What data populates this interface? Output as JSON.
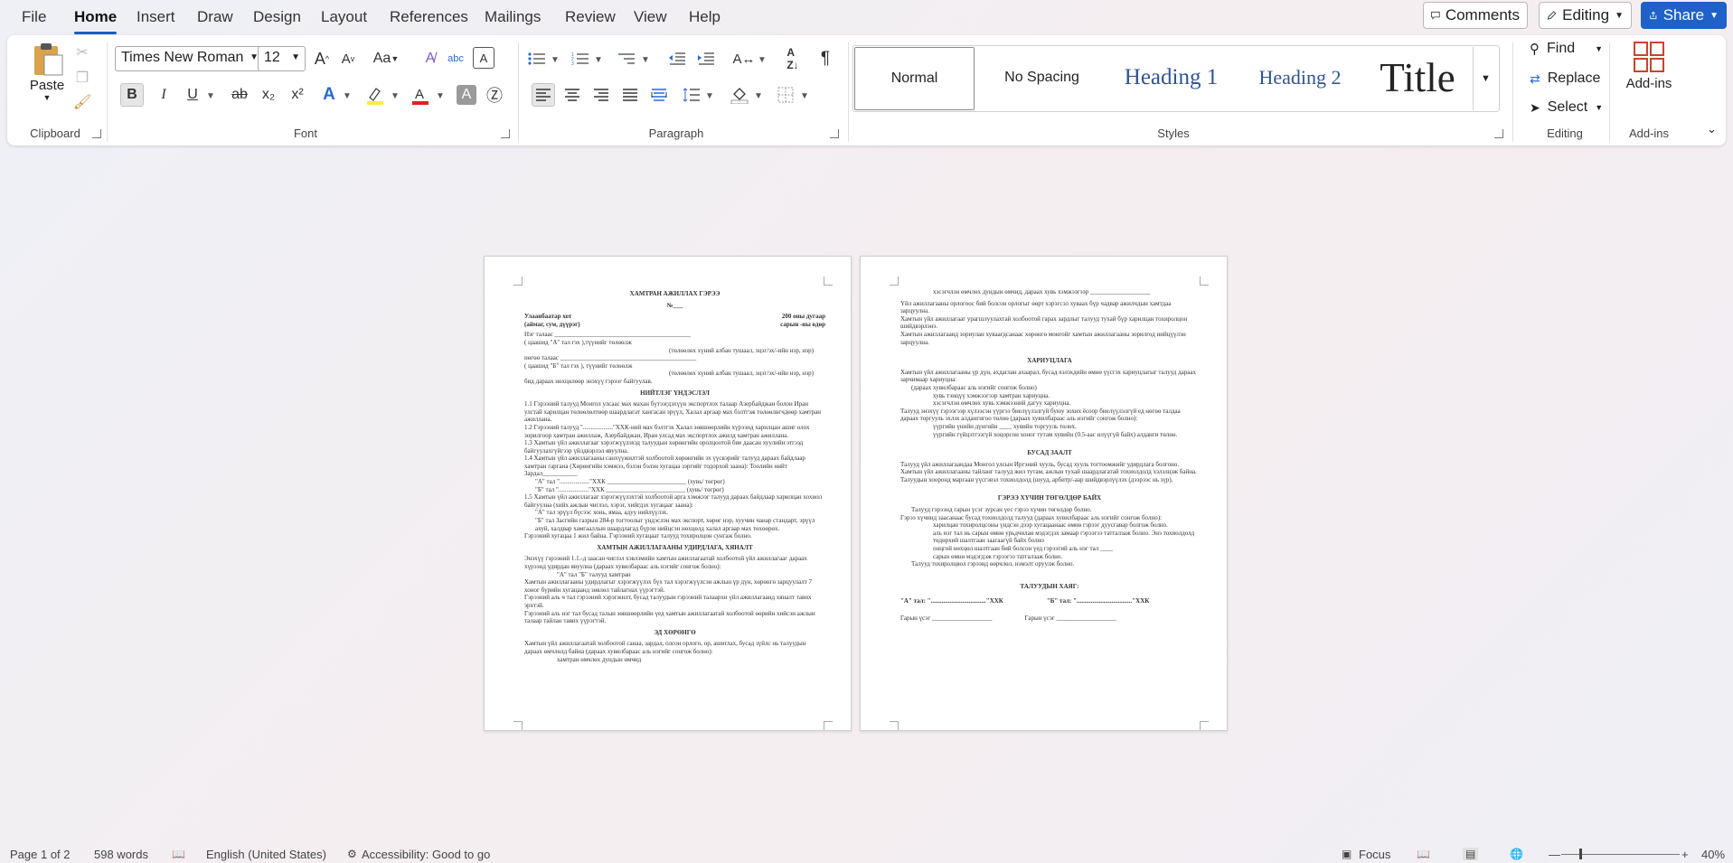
{
  "menu": {
    "items": [
      "File",
      "Home",
      "Insert",
      "Draw",
      "Design",
      "Layout",
      "References",
      "Mailings",
      "Review",
      "View",
      "Help"
    ],
    "active": "Home"
  },
  "topbar": {
    "comments": "Comments",
    "editing": "Editing",
    "share": "Share"
  },
  "ribbon": {
    "clipboard": {
      "paste": "Paste",
      "label": "Clipboard"
    },
    "font": {
      "name": "Times New Roman",
      "size": "12",
      "label": "Font",
      "bold": "B",
      "italic": "I",
      "underline": "U",
      "strike": "ab",
      "sub": "x₂",
      "sup": "x²",
      "case": "Aa",
      "grow": "A",
      "shrink": "A"
    },
    "paragraph": {
      "label": "Paragraph",
      "pilcrow": "¶"
    },
    "styles": {
      "label": "Styles",
      "items": [
        "Normal",
        "No Spacing",
        "Heading 1",
        "Heading 2",
        "Title"
      ]
    },
    "editing": {
      "find": "Find",
      "replace": "Replace",
      "select": "Select",
      "label": "Editing"
    },
    "addins": {
      "button": "Add-ins",
      "label": "Add-ins"
    }
  },
  "colors": {
    "accent": "#1e61c9",
    "highlight": "#ffeb3b",
    "fontcolor": "#e02020",
    "heading": "#2f5496"
  },
  "page1": {
    "title": "ХАМТРАН АЖИЛЛАХ ГЭРЭЭ",
    "no": "№___",
    "city": "Улаанбаатар хот",
    "citysub": "(аймаг, сум, дүүрэг)",
    "date": "200  оны    дугаар",
    "datesub": "сарын    -ны өдөр",
    "l1": "Нэг талаас ___________________________________________",
    "l2": "( цаашид \"А\" тал гэх ),түүнийг төлөөлж",
    "l3": "(төлөөлөх хүний албан тушаал, эцэг/эх/-ийн нэр, нэр)",
    "l4": "нөгөө талаас ___________________________________________",
    "l5": "( цаашид \"Б\" тал гэх ), түүнийг төлөөлж",
    "l6": "(төлөөлөх хүний албан тушаал, эцэг/эх/-ийн нэр, нэр)",
    "l7": "бид дараах нөхцөлөөр энэхүү гэрээг байгуулав.",
    "h1": "НИЙТЛЭГ ҮНДЭСЛЭЛ",
    "p1": "1.1 Гэрээний талууд Монгол улсаас мах махан бүтээгдэхүүн экспортлох талаар Азербайджан болон Иран улстай харилцан төлөөлөлтөөр шаардлагат хангасан эрүүл, Халал аргаар мах бэлтгэж төлөөлөгчдөөр хамтран ажиллана.",
    "p2": "1.2 Гэрээний талууд \"...................\"ХХК-ний мах бэлтгэх Халал зөвшөөрлийн хүрээнд харилцан ашиг олох зорилгоор хамтран ажиллаж, Азербайджан, Иран улсад мах экспортлох ажилд хамтран ажиллана.",
    "p3": "1.3 Хамтын үйл ажиллагааг хэрэгжүүлэхэд талуудын хөрөнгийн оролцоотой бие даасан хуулийн этгээд байгуулахгүйгээр үйлдвэрлэл явуулна.",
    "p4": "1.4 Хамтын үйл ажиллагааны санхүүжилтэй холбоотой хөрөнгийн эх үүсвэрийг талууд дараах байдлаар хамтран гаргана (Хөрөнгийн хэмжээ, бэлэн бэлэн хугацаа зэргийг тодорхой заана): Тоолийн нийт Зардал___________",
    "p5": "\"А\" тал \"...................\"ХХК _________________________ (хувь/ төгрөг)",
    "p6": "\"Б\" тал \"...................\"ХХК _________________________ (хувь/ төгрөг)",
    "p7": "1.5 Хамтын үйл ажиллагааг хэрэгжүүлэхтэй холбоотой арга хэмжээг талууд дараах байдлаар харилцан хохиол байгуулна (хийх ажлын чиглэл, хэрэг, хийгдэх хугацааг заана):",
    "p8": "\"А\" тал эрүүл бүсээс хонь, ямаа, адуу нийлүүлэх.",
    "p9": "\"Б\" тал Засгийн газрын 284-р тогтоолыг үндэслэн мах экспорт, хөрөг нэр, хуучин чанар стандарт, эрүүл ахуй, халдвар хамгааллын шаардлагад бүрэн нийцсэн нөхцөлд халал аргаар мах төхөөрөх.",
    "p10": "Гэрээний хугацаа 1 жил байна. Гэрээний хугацааг талууд тохиролцон сунгаж болно.",
    "h2": "ХАМТЫН АЖИЛЛАГААНЫ УДИРДЛАГА, ХЯНАЛТ",
    "p11": "Энэхүү гэрээний 1.1.-д заасан чиглэл хэвлэмийн хамтын ажиллагаатай холбоотой үйл ажиллагааг дараах хүрээнд удирдан явуулна (дараах хувилбараас аль нэгийг сонгож болно):",
    "p12": "\"А\" тал \"Б\" талууд хамтран",
    "p13": "Хамтын ажиллагааны удирдлагыг хэрэгжүүлэх бүх тал хэрэгжүүлсэн ажлын үр дүн, хөрөнгө зарцуулалт 7 хоног бүрийн хугацаанд зөвлөл тайлагнах үүрэгтэй.",
    "p14": "Гэрээний аль ч тал гэрээний хэрэгжилт, бусад талуудын гэрээний талаархи үйл ажиллагаанд хяналт тавих эрхтэй.",
    "p15": "Гэрээний аль нэг тал бусад талын зөвшөөрлийн үед хамтын ажиллагаатай холбоотой өөрийн хийсэн ажлын талаар тайлан тавих үүрэгтэй.",
    "h3": "ЭД ХӨРӨНГӨ",
    "p16": "Хамтын үйл ажиллагаатай холбоотой санаа, зардал, олсон орлого, ор, ашиглах, бусад зүйлс нь талуудын дараах өмчлөлд байна (дараах хувилбараас аль нэгийг сонгож болно):",
    "p17": "хамтран өмчлөх дундын өмчид"
  },
  "page2": {
    "q1": "хэсэгчлэн өмчлөх дундын өмчид, дараах хувь хэмжээгээр ___________________",
    "q2": "Үйл ажиллагааны орлогоос бий болсон орлогыг өөрт хэрэгсэл хуваах бүр чадвар ажилчдын хамтдаа зарцуулна.",
    "q3": "Хамтын үйл ажиллагааг урагшлуулахтай холбоотой гарах зардлыг талууд тухай бүр харилцан тохиролцон шийдвэрлэнэ.",
    "q4": "Хамтын ажиллагаанд зориулан хуваагдсанаас хөрөнгө монгойг хамтын ажиллагааны зорилгод нийцүүлэн зарцуулна.",
    "h1": "ХАРИУЦЛАГА",
    "q5": "Хамтын үйл ажиллагааны үр дүн, ахдаглан ахаарал, бусад хэлэхдийн өмнө үүсгэх хариуцлагыг талууд дараах зарчимаар хариуцна:",
    "q6": "(дараах хувилбараас аль нэгийг сонгож болно)",
    "q7": "хувь тэнцүү хэмжээгээр хамтран хариуцна.",
    "q8": "хэсэгчлэн өмчлөх хувь хэмжээний дагуу хариуцна.",
    "q9": "Талууд энэхүү гэрээгээр хүлээсэн үүргээ биелүүлэлгүй буюу зохих ёсоор биелүүлэлгүй ед нөгөө талдаа дараах торгууль эхлэх алдангигоо төлнө (дараах хувилбараас аль нэгийг сонгож болно):",
    "q10": "үүргийн үнийн дүнгийн ____ хувийн торгууль төлөх.",
    "q11": "үүргийн гүйцэтгээгүй хоцорсон хоног тутам      хувийн (0.5-аас илүүгүй байх) алданги төлнө.",
    "h2": "БУСАД ЗААЛТ",
    "q12": "Талууд үйл ажиллагаандаа Монгол улсын Иргэний хууль, бусад хууль тогтоомжийг удирдлага болгоно.",
    "q13": "Хамтын үйл ажиллагааны тайланг талууд жил тутам, ажлын тухай шаардлагатай тохиолдолд хэлэлцэж байна.",
    "q14": "Талуудын хооронд маргаан үүсгэвэл тохиолдолд (шууд, арбитр/-аар шийдвэрлүүлэх (дээрээс нь зүр).",
    "h3": "ГЭРЭЭ ХҮЧИН ТӨГӨЛДӨР БАЙХ",
    "q15": "Талууд гэрээнд гарын үсэг зурсан үес гэрээ хүчин төгөлдөр болно.",
    "q16": "Гэрээ хүчинд заасанаас бусад тохиолдолд талууд (дараах хувилбараас аль нэгийг сонгож болно):",
    "q17": "харилцан тохиролцсоны үндсэн дээр хугацаанаас өмнө гэрээг дуусгавар болгож болно.",
    "q18": "аль нэг тал нь     сарын өмнө урьдчилан мэдэгдэх замаар гэрээгээ татгалзаж болно. Энэ тохиолдолд төдөрхий шалтгаан заагаагүй байх болно",
    "q19": "онцгой нөхцөл шалтгаан бий болсон үед гэрээгий аль нэг тал ____",
    "q20": "сарын өмнө мэдэгдэж гэрээгээ татгалзаж болно.",
    "q21": "Талууд тохиролцвол гэрээнд өөрчлөл, нэмэлт оруулж болно.",
    "h4": "ТАЛУУДЫН ХАЯГ:",
    "sa": "\"А\" тал: \"...................................\"ХХК",
    "sb": "\"Б\" тал: \"...................................\"ХХК",
    "siga": "Гарын үсэг ___________________",
    "sigb": "Гарын үсэг ___________________"
  },
  "status": {
    "page": "Page 1 of 2",
    "words": "598 words",
    "language": "English (United States)",
    "accessibility": "Accessibility: Good to go",
    "focus": "Focus",
    "zoom": "40%"
  }
}
